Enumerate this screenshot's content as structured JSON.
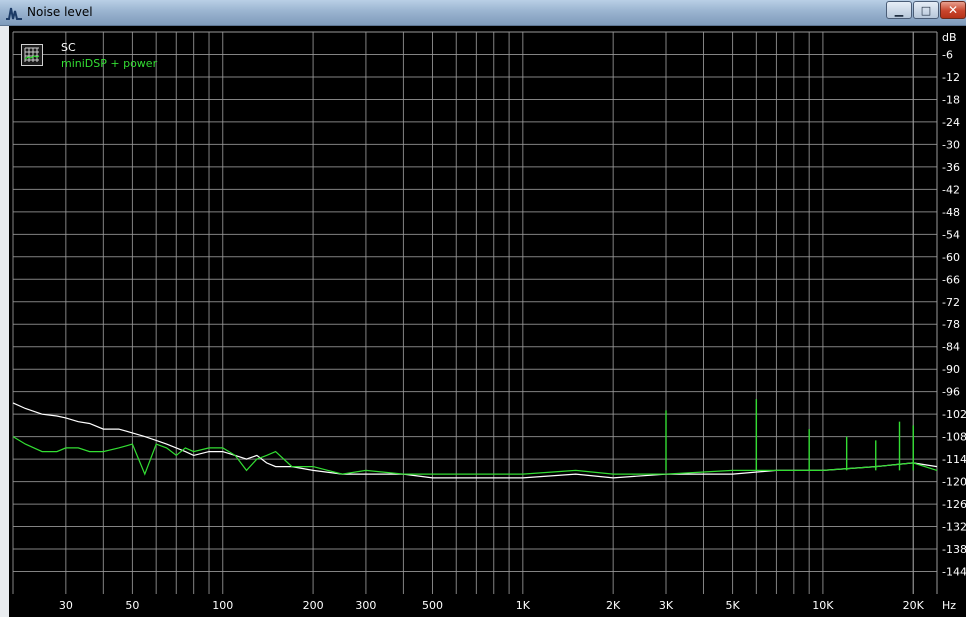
{
  "window": {
    "title": "Noise level",
    "controls": {
      "minimize": "▁",
      "maximize": "□",
      "close": "✕"
    },
    "icon": "waveform-icon"
  },
  "colors": {
    "background": "#000000",
    "grid": "#9a9a9a",
    "text": "#ffffff",
    "series_sc": "#ffffff",
    "series_minidsp": "#33dd33"
  },
  "chart_data": {
    "type": "line",
    "title": "",
    "xlabel": "Hz",
    "ylabel": "dB",
    "x_scale": "log",
    "xlim": [
      20,
      24000
    ],
    "ylim": [
      -150,
      0
    ],
    "grid": true,
    "legend_placement": "top-left",
    "x_ticks": [
      {
        "value": 30,
        "label": "30"
      },
      {
        "value": 50,
        "label": "50"
      },
      {
        "value": 100,
        "label": "100"
      },
      {
        "value": 200,
        "label": "200"
      },
      {
        "value": 300,
        "label": "300"
      },
      {
        "value": 500,
        "label": "500"
      },
      {
        "value": 1000,
        "label": "1K"
      },
      {
        "value": 2000,
        "label": "2K"
      },
      {
        "value": 3000,
        "label": "3K"
      },
      {
        "value": 5000,
        "label": "5K"
      },
      {
        "value": 10000,
        "label": "10K"
      },
      {
        "value": 20000,
        "label": "20K"
      }
    ],
    "y_ticks": [
      {
        "value": -6,
        "label": "-6"
      },
      {
        "value": -12,
        "label": "-12"
      },
      {
        "value": -18,
        "label": "-18"
      },
      {
        "value": -24,
        "label": "-24"
      },
      {
        "value": -30,
        "label": "-30"
      },
      {
        "value": -36,
        "label": "-36"
      },
      {
        "value": -42,
        "label": "-42"
      },
      {
        "value": -48,
        "label": "-48"
      },
      {
        "value": -54,
        "label": "-54"
      },
      {
        "value": -60,
        "label": "-60"
      },
      {
        "value": -66,
        "label": "-66"
      },
      {
        "value": -72,
        "label": "-72"
      },
      {
        "value": -78,
        "label": "-78"
      },
      {
        "value": -84,
        "label": "-84"
      },
      {
        "value": -90,
        "label": "-90"
      },
      {
        "value": -96,
        "label": "-96"
      },
      {
        "value": -102,
        "label": "-102"
      },
      {
        "value": -108,
        "label": "-108"
      },
      {
        "value": -114,
        "label": "-114"
      },
      {
        "value": -120,
        "label": "-120"
      },
      {
        "value": -126,
        "label": "-126"
      },
      {
        "value": -132,
        "label": "-132"
      },
      {
        "value": -138,
        "label": "-138"
      },
      {
        "value": -144,
        "label": "-144"
      }
    ],
    "series": [
      {
        "name": "SC",
        "color": "#ffffff",
        "x": [
          20,
          22,
          25,
          28,
          30,
          33,
          36,
          40,
          45,
          50,
          55,
          60,
          65,
          70,
          75,
          80,
          90,
          100,
          110,
          120,
          130,
          140,
          150,
          170,
          200,
          250,
          300,
          400,
          500,
          700,
          1000,
          1500,
          2000,
          3000,
          5000,
          7000,
          10000,
          15000,
          20000,
          24000
        ],
        "y": [
          -99,
          -100.5,
          -102,
          -102.5,
          -103,
          -104,
          -104.5,
          -106,
          -106,
          -107,
          -108,
          -109,
          -110,
          -111,
          -112,
          -113,
          -112,
          -112,
          -113,
          -114,
          -113,
          -115,
          -116,
          -116,
          -117,
          -118,
          -118,
          -118,
          -119,
          -119,
          -119,
          -118,
          -119,
          -118,
          -118,
          -117,
          -117,
          -116,
          -115,
          -116
        ]
      },
      {
        "name": "miniDSP + power",
        "color": "#33dd33",
        "x": [
          20,
          22,
          25,
          28,
          30,
          33,
          36,
          40,
          45,
          50,
          55,
          60,
          65,
          70,
          75,
          80,
          90,
          100,
          110,
          120,
          130,
          140,
          150,
          170,
          200,
          250,
          300,
          400,
          500,
          700,
          1000,
          1500,
          2000,
          3000,
          5000,
          7000,
          10000,
          15000,
          20000,
          24000
        ],
        "y": [
          -108,
          -110,
          -112,
          -112,
          -111,
          -111,
          -112,
          -112,
          -111,
          -110,
          -118,
          -110,
          -111,
          -113,
          -111,
          -112,
          -111,
          -111,
          -113,
          -117,
          -114,
          -113,
          -112,
          -116,
          -116,
          -118,
          -117,
          -118,
          -118,
          -118,
          -118,
          -117,
          -118,
          -118,
          -117,
          -117,
          -117,
          -116,
          -115,
          -117
        ]
      }
    ],
    "spikes": {
      "series": "miniDSP + power",
      "x": [
        3000,
        6000,
        9000,
        12000,
        15000,
        18000,
        20000
      ],
      "y": [
        -101,
        -98,
        -106,
        -108,
        -109,
        -104,
        -105
      ]
    }
  }
}
